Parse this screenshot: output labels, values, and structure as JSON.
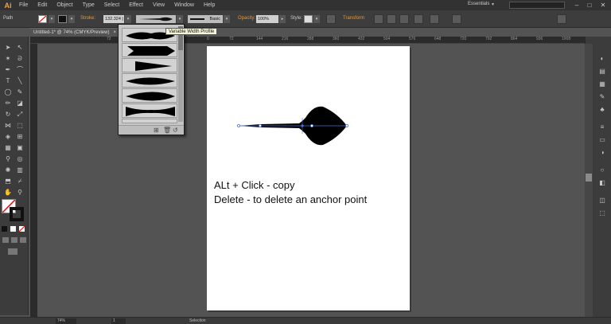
{
  "app": {
    "logo": "Ai",
    "menu": [
      "File",
      "Edit",
      "Object",
      "Type",
      "Select",
      "Effect",
      "View",
      "Window",
      "Help"
    ],
    "workspace": "Essentials",
    "search_placeholder": "",
    "window_controls": [
      "–",
      "□",
      "✕"
    ]
  },
  "control_bar": {
    "selection_label": "Path",
    "stroke_label": "Stroke:",
    "stroke_value": "132.324 |",
    "profile_label": "Basic",
    "opacity_label": "Opacity:",
    "opacity_value": "100%",
    "style_label": "Style:",
    "transform_label": "Transform"
  },
  "tooltip": "Variable Width Profile",
  "document_tab": {
    "title": "Untitled-1* @ 74% (CMYK/Preview)",
    "close": "×"
  },
  "ruler_ticks": [
    "72",
    "0",
    "72",
    "144",
    "216",
    "288",
    "360",
    "432",
    "504",
    "576",
    "648",
    "720",
    "792",
    "864",
    "936",
    "1008"
  ],
  "width_profiles": [
    "profile-1",
    "profile-2",
    "profile-3",
    "profile-4",
    "profile-5",
    "profile-6",
    "profile-7"
  ],
  "artboard": {
    "line1": "ALt + Click - copy",
    "line2": "Delete - to delete an anchor point"
  },
  "status_bar": {
    "zoom": "74%",
    "page": "1",
    "mode": "Selection"
  },
  "colors": {
    "accent_orange": "#e8992f",
    "canvas": "#535353",
    "artboard": "#ffffff"
  }
}
